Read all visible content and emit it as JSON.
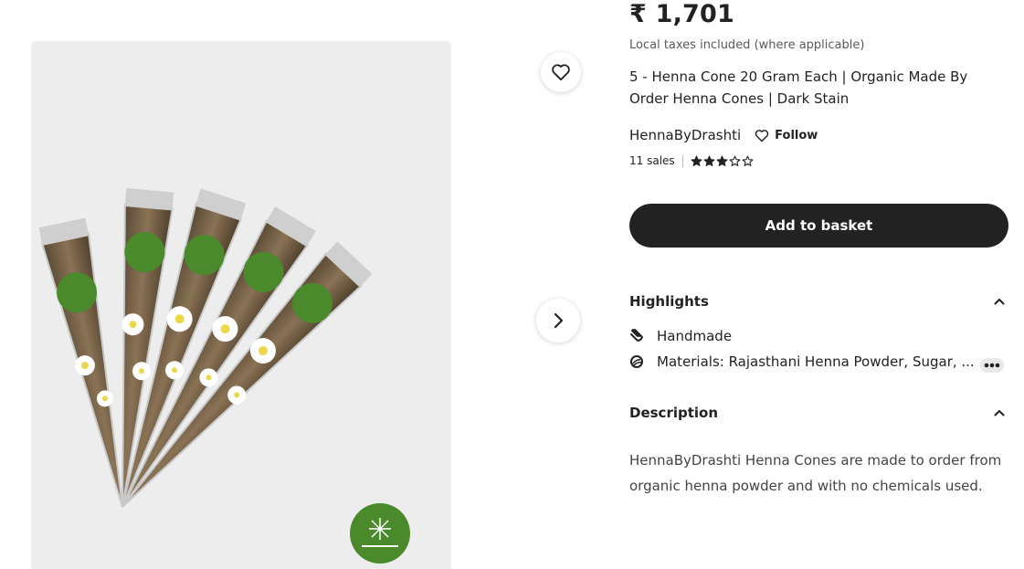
{
  "product": {
    "price": "₹ 1,701",
    "tax_note": "Local taxes included (where applicable)",
    "title": "5 - Henna Cone 20 Gram Each | Organic Made By Order Henna Cones | Dark Stain"
  },
  "shop": {
    "name": "HennaByDrashti",
    "follow_label": "Follow",
    "sales": "11 sales",
    "rating_stars": 3,
    "rating_max": 5
  },
  "actions": {
    "add_to_basket": "Add to basket"
  },
  "highlights": {
    "header": "Highlights",
    "items": [
      {
        "icon": "hand-icon",
        "label": "Handmade"
      },
      {
        "icon": "materials-icon",
        "label": "Materials: Rajasthani Henna Powder, Sugar, ..."
      }
    ]
  },
  "description": {
    "header": "Description",
    "text": "HennaByDrashti Henna Cones are made to order from organic henna powder and with no chemicals used."
  },
  "colors": {
    "button_bg": "#222222",
    "image_bg": "#ededed",
    "sticker_green": "#4a8a2c"
  }
}
